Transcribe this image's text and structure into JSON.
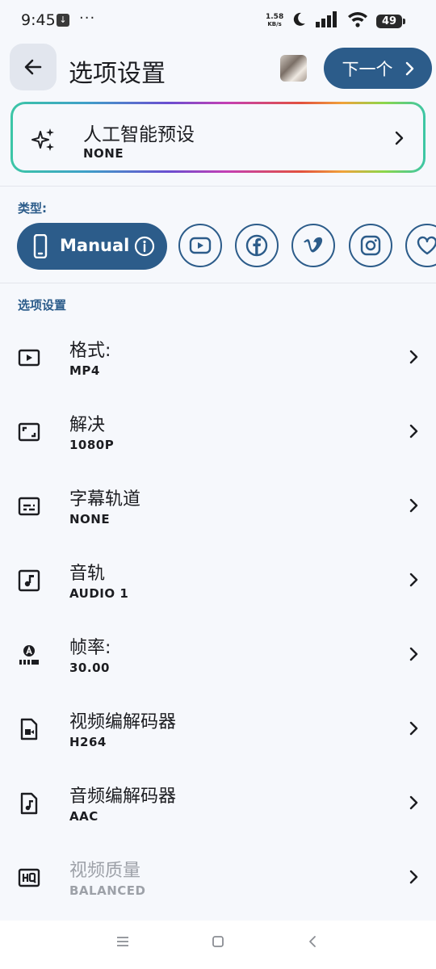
{
  "status_bar": {
    "time": "9:45",
    "more": "···",
    "net_speed_value": "1.58",
    "net_speed_unit": "KB/s",
    "battery": "49"
  },
  "header": {
    "title": "选项设置",
    "next_label": "下一个"
  },
  "preset": {
    "title": "人工智能预设",
    "value": "NONE"
  },
  "types": {
    "label": "类型:",
    "items": [
      {
        "label": "Manual",
        "icon": "phone-icon",
        "selected": true
      },
      {
        "icon": "youtube-icon"
      },
      {
        "icon": "facebook-icon"
      },
      {
        "icon": "vimeo-icon"
      },
      {
        "icon": "instagram-icon"
      },
      {
        "icon": "heart-icon"
      }
    ]
  },
  "options": {
    "label": "选项设置",
    "items": [
      {
        "title": "格式:",
        "value": "MP4",
        "icon": "video-format-icon"
      },
      {
        "title": "解决",
        "value": "1080P",
        "icon": "resolution-icon"
      },
      {
        "title": "字幕轨道",
        "value": "NONE",
        "icon": "subtitles-icon"
      },
      {
        "title": "音轨",
        "value": "AUDIO 1",
        "icon": "audio-track-icon"
      },
      {
        "title": "帧率:",
        "value": "30.00",
        "icon": "frame-rate-icon"
      },
      {
        "title": "视频编解码器",
        "value": "H264",
        "icon": "video-codec-icon"
      },
      {
        "title": "音频编解码器",
        "value": "AAC",
        "icon": "audio-codec-icon"
      },
      {
        "title": "视频质量",
        "value": "BALANCED",
        "icon": "hq-icon",
        "disabled": true
      }
    ]
  },
  "colors": {
    "accent": "#2c5c8a",
    "background": "#f6f8fc",
    "text": "#1c1d21",
    "disabled_text": "#9da1a8"
  }
}
